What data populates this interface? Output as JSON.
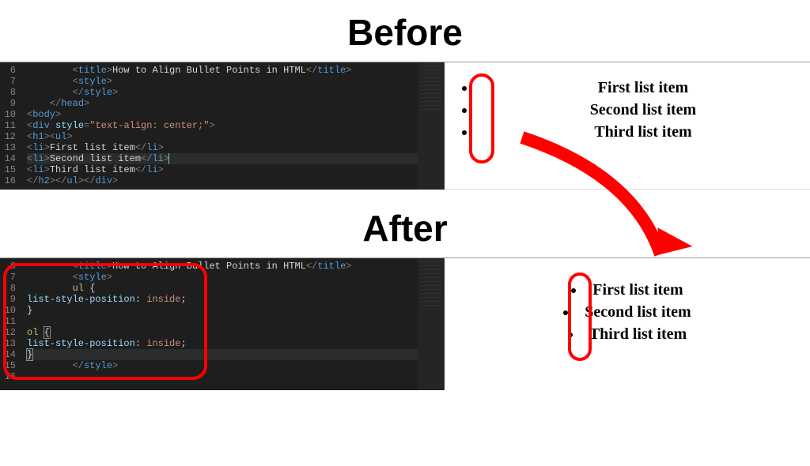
{
  "headings": {
    "before": "Before",
    "after": "After"
  },
  "before": {
    "gutter": [
      "6",
      "7",
      "8",
      "9",
      "10",
      "11",
      "12",
      "13",
      "14",
      "15",
      "16"
    ],
    "code_lines": [
      {
        "indent": "        ",
        "parts": [
          [
            "tag",
            "<"
          ],
          [
            "tagname",
            "title"
          ],
          [
            "tag",
            ">"
          ],
          [
            "txt",
            "How to Align Bullet Points in HTML"
          ],
          [
            "tag",
            "</"
          ],
          [
            "tagname",
            "title"
          ],
          [
            "tag",
            ">"
          ]
        ]
      },
      {
        "indent": "        ",
        "parts": [
          [
            "tag",
            "<"
          ],
          [
            "tagname",
            "style"
          ],
          [
            "tag",
            ">"
          ]
        ]
      },
      {
        "indent": "        ",
        "parts": [
          [
            "tag",
            "</"
          ],
          [
            "tagname",
            "style"
          ],
          [
            "tag",
            ">"
          ]
        ]
      },
      {
        "indent": "    ",
        "parts": [
          [
            "tag",
            "</"
          ],
          [
            "tagname",
            "head"
          ],
          [
            "tag",
            ">"
          ]
        ]
      },
      {
        "indent": "",
        "parts": [
          [
            "tag",
            "<"
          ],
          [
            "tagname",
            "body"
          ],
          [
            "tag",
            ">"
          ]
        ]
      },
      {
        "indent": "",
        "parts": [
          [
            "tag",
            "<"
          ],
          [
            "tagname",
            "div"
          ],
          [
            "txt",
            " "
          ],
          [
            "attr",
            "style"
          ],
          [
            "tag",
            "="
          ],
          [
            "str",
            "\"text-align: center;\""
          ],
          [
            "tag",
            ">"
          ]
        ]
      },
      {
        "indent": "",
        "parts": [
          [
            "tag",
            "<"
          ],
          [
            "tagname",
            "h1"
          ],
          [
            "tag",
            ">"
          ],
          [
            "tag",
            "<"
          ],
          [
            "tagname",
            "ul"
          ],
          [
            "tag",
            ">"
          ]
        ]
      },
      {
        "indent": "",
        "parts": [
          [
            "tag",
            "<"
          ],
          [
            "tagname",
            "li"
          ],
          [
            "tag",
            ">"
          ],
          [
            "txt",
            "First list item"
          ],
          [
            "tag",
            "</"
          ],
          [
            "tagname",
            "li"
          ],
          [
            "tag",
            ">"
          ]
        ]
      },
      {
        "indent": "",
        "parts": [
          [
            "tag",
            "<"
          ],
          [
            "tagname",
            "li"
          ],
          [
            "tag",
            ">"
          ],
          [
            "txt",
            "Second list item"
          ],
          [
            "tag",
            "</"
          ],
          [
            "tagname",
            "li"
          ],
          [
            "tag",
            ">"
          ],
          [
            "cursor",
            ""
          ]
        ]
      },
      {
        "indent": "",
        "parts": [
          [
            "tag",
            "<"
          ],
          [
            "tagname",
            "li"
          ],
          [
            "tag",
            ">"
          ],
          [
            "txt",
            "Third list item"
          ],
          [
            "tag",
            "</"
          ],
          [
            "tagname",
            "li"
          ],
          [
            "tag",
            ">"
          ]
        ]
      },
      {
        "indent": "",
        "parts": [
          [
            "tag",
            "</"
          ],
          [
            "tagname",
            "h2"
          ],
          [
            "tag",
            ">"
          ],
          [
            "tag",
            "</"
          ],
          [
            "tagname",
            "ul"
          ],
          [
            "tag",
            ">"
          ],
          [
            "tag",
            "</"
          ],
          [
            "tagname",
            "div"
          ],
          [
            "tag",
            ">"
          ]
        ]
      }
    ],
    "output_items": [
      "First list item",
      "Second list item",
      "Third list item"
    ]
  },
  "after": {
    "gutter": [
      "6",
      "7",
      "8",
      "9",
      "10",
      "11",
      "12",
      "13",
      "14",
      "15",
      "16"
    ],
    "code_lines": [
      {
        "indent": "        ",
        "parts": [
          [
            "tag",
            "<"
          ],
          [
            "tagname",
            "title"
          ],
          [
            "tag",
            ">"
          ],
          [
            "txt",
            "How to Align Bullet Points in HTML"
          ],
          [
            "tag",
            "</"
          ],
          [
            "tagname",
            "title"
          ],
          [
            "tag",
            ">"
          ]
        ]
      },
      {
        "indent": "        ",
        "parts": [
          [
            "tag",
            "<"
          ],
          [
            "tagname",
            "style"
          ],
          [
            "tag",
            ">"
          ]
        ]
      },
      {
        "indent": "        ",
        "parts": [
          [
            "sel",
            "ul "
          ],
          [
            "brace",
            "{"
          ]
        ]
      },
      {
        "indent": "",
        "parts": [
          [
            "prop",
            "list-style-position"
          ],
          [
            "txt",
            ": "
          ],
          [
            "val",
            "inside"
          ],
          [
            "txt",
            ";"
          ]
        ]
      },
      {
        "indent": "",
        "parts": [
          [
            "brace",
            "}"
          ]
        ]
      },
      {
        "indent": "",
        "parts": [
          [
            "txt",
            ""
          ]
        ]
      },
      {
        "indent": "",
        "parts": [
          [
            "sel",
            "ol "
          ],
          [
            "bracket",
            "{"
          ]
        ]
      },
      {
        "indent": "",
        "parts": [
          [
            "prop",
            "list-style-position"
          ],
          [
            "txt",
            ": "
          ],
          [
            "val",
            "inside"
          ],
          [
            "txt",
            ";"
          ]
        ]
      },
      {
        "indent": "",
        "parts": [
          [
            "bracket",
            "}"
          ]
        ]
      },
      {
        "indent": "        ",
        "parts": [
          [
            "tag",
            "</"
          ],
          [
            "tagname",
            "style"
          ],
          [
            "tag",
            ">"
          ]
        ]
      }
    ],
    "output_items": [
      "First list item",
      "Second list item",
      "Third list item"
    ]
  }
}
